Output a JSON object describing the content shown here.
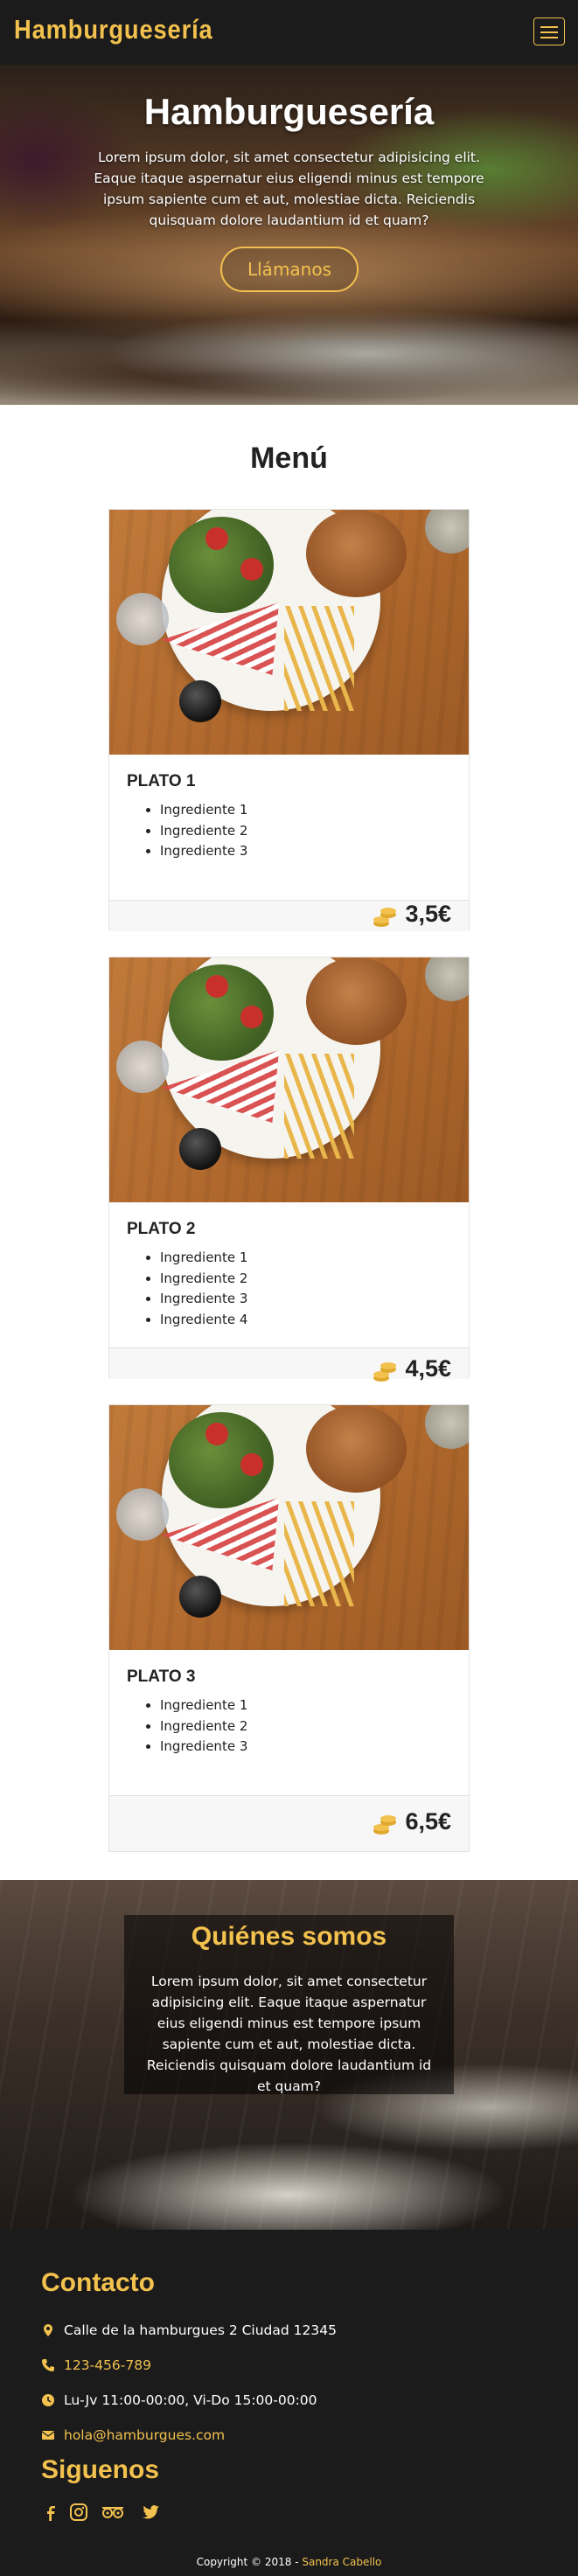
{
  "nav": {
    "brand": "Hamburguesería",
    "menu_toggle_icon": "hamburger-menu-icon"
  },
  "hero": {
    "title": "Hamburguesería",
    "text": "Lorem ipsum dolor, sit amet consectetur adipisicing elit. Eaque itaque aspernatur eius eligendi minus est tempore ipsum sapiente cum et aut, molestiae dicta. Reiciendis quisquam dolore laudantium id et quam?",
    "cta": "Llámanos"
  },
  "menu": {
    "title": "Menú",
    "items": [
      {
        "name": "PLATO 1",
        "ingredients": [
          "Ingrediente 1",
          "Ingrediente 2",
          "Ingrediente 3"
        ],
        "price": "3,5€"
      },
      {
        "name": "PLATO 2",
        "ingredients": [
          "Ingrediente 1",
          "Ingrediente 2",
          "Ingrediente 3",
          "Ingrediente 4"
        ],
        "price": "4,5€"
      },
      {
        "name": "PLATO 3",
        "ingredients": [
          "Ingrediente 1",
          "Ingrediente 2",
          "Ingrediente 3"
        ],
        "price": "6,5€"
      }
    ],
    "price_icon": "coins-icon"
  },
  "about": {
    "title": "Quiénes somos",
    "text": "Lorem ipsum dolor, sit amet consectetur adipisicing elit. Eaque itaque aspernatur eius eligendi minus est tempore ipsum sapiente cum et aut, molestiae dicta. Reiciendis quisquam dolore laudantium id et quam?"
  },
  "contact": {
    "title": "Contacto",
    "address": "Calle de la hamburgues 2 Ciudad 12345",
    "phone": "123-456-789",
    "hours": "Lu-Jv 11:00-00:00, Vi-Do 15:00-00:00",
    "email": "hola@hamburgues.com"
  },
  "social": {
    "title": "Siguenos",
    "icons": [
      "facebook-icon",
      "instagram-icon",
      "tripadvisor-icon",
      "twitter-icon"
    ]
  },
  "footer": {
    "copyright": "Copyright © 2018 - ",
    "author": "Sandra Cabello"
  },
  "colors": {
    "accent": "#f2c14e",
    "dark": "#1b1b1b"
  }
}
